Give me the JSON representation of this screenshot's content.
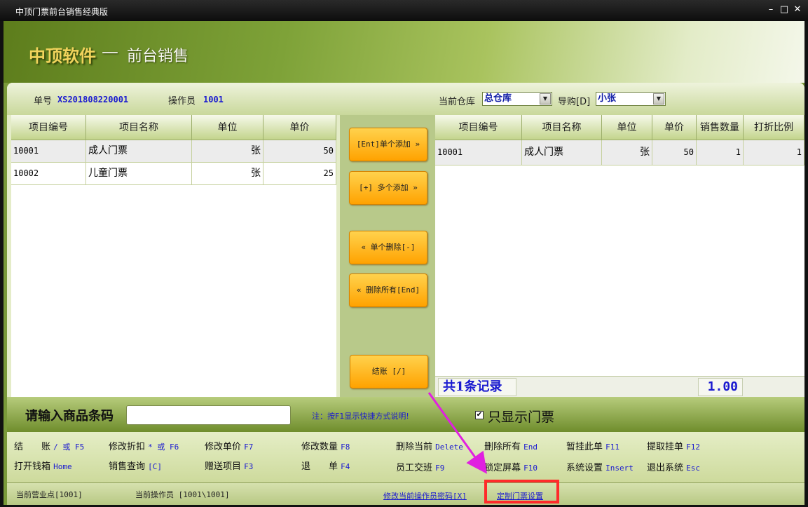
{
  "window": {
    "title": "中顶门票前台销售经典版",
    "minimize": "–",
    "maximize": "□",
    "close": "✕"
  },
  "banner": {
    "brand": "中顶软件",
    "dash": "—",
    "subtitle": "前台销售"
  },
  "info": {
    "order_label": "单号",
    "order_value": "XS201808220001",
    "operator_label": "操作员",
    "operator_value": "1001",
    "warehouse_label": "当前仓库",
    "warehouse_value": "总仓库",
    "guide_label": "导购[D]",
    "guide_value": "小张"
  },
  "left_table": {
    "headers": [
      "项目编号",
      "项目名称",
      "单位",
      "单价"
    ],
    "rows": [
      [
        "10001",
        "成人门票",
        "张",
        "50"
      ],
      [
        "10002",
        "儿童门票",
        "张",
        "25"
      ]
    ]
  },
  "right_table": {
    "headers": [
      "项目编号",
      "项目名称",
      "单位",
      "单价",
      "销售数量",
      "打折比例"
    ],
    "rows": [
      [
        "10001",
        "成人门票",
        "张",
        "50",
        "1",
        "1"
      ]
    ]
  },
  "buttons": {
    "add_single": "[Ent]单个添加 »",
    "add_multi": "[+] 多个添加 »",
    "del_single": "« 单个删除[-]",
    "del_all": "« 删除所有[End]",
    "checkout": "结账 [/]"
  },
  "summary": {
    "records": "共1条记录",
    "total": "1.00"
  },
  "barcode": {
    "label": "请输入商品条码",
    "value": "",
    "note": "注：按F1显示快捷方式说明!",
    "checkbox_label": "只显示门票",
    "checked": true
  },
  "shortcuts": [
    {
      "label": "结　　账",
      "key": "/ 或 F5"
    },
    {
      "label": "修改折扣",
      "key": "* 或 F6"
    },
    {
      "label": "修改单价",
      "key": "F7"
    },
    {
      "label": "修改数量",
      "key": "F8"
    },
    {
      "label": "删除当前",
      "key": "Delete"
    },
    {
      "label": "删除所有",
      "key": "End"
    },
    {
      "label": "暂挂此单",
      "key": "F11"
    },
    {
      "label": "提取挂单",
      "key": "F12"
    },
    {
      "label": "打开钱箱",
      "key": "Home"
    },
    {
      "label": "销售查询",
      "key": "[C]"
    },
    {
      "label": "赠送项目",
      "key": "F3"
    },
    {
      "label": "退　　单",
      "key": "F4"
    },
    {
      "label": "员工交班",
      "key": "F9"
    },
    {
      "label": "锁定屏幕",
      "key": "F10"
    },
    {
      "label": "系统设置",
      "key": "Insert"
    },
    {
      "label": "退出系统",
      "key": "Esc"
    }
  ],
  "status": {
    "sales_point": "当前营业点[1001]",
    "operator": "当前操作员 [1001\\1001]",
    "change_pwd": "修改当前操作员密码[X]",
    "ticket_setup": "定制门票设置"
  },
  "colors": {
    "accent_blue": "#1a1ad0",
    "button_orange": "#ffa200",
    "highlight_red": "#ff2a2a",
    "arrow_magenta": "#e020e0"
  }
}
